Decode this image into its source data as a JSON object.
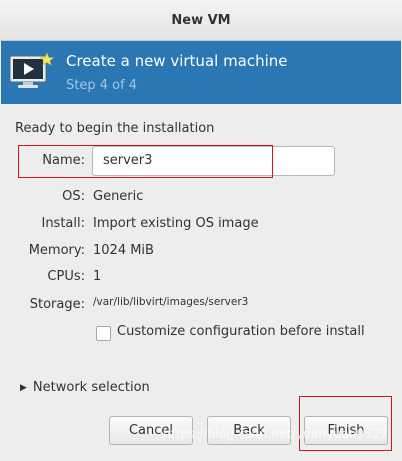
{
  "window": {
    "title": "New VM"
  },
  "banner": {
    "icon": "monitor-play-icon",
    "title": "Create a new virtual machine",
    "step": "Step 4 of 4"
  },
  "summary": {
    "heading": "Ready to begin the installation",
    "name_label": "Name:",
    "name_value": "server3",
    "os_label": "OS:",
    "os_value": "Generic",
    "install_label": "Install:",
    "install_value": "Import existing OS image",
    "memory_label": "Memory:",
    "memory_value": "1024 MiB",
    "cpus_label": "CPUs:",
    "cpus_value": "1",
    "storage_label": "Storage:",
    "storage_value": "/var/lib/libvirt/images/server3"
  },
  "customize": {
    "label": "Customize configuration before install",
    "checked": false
  },
  "network": {
    "label": "Network selection"
  },
  "buttons": {
    "cancel": "Cancel",
    "back": "Back",
    "finish": "Finish"
  },
  "watermark": "https://blog.csdn.net/yuanyuan9527",
  "colors": {
    "banner": "#2a77b3",
    "banner_step": "#9fc7ea",
    "highlight": "#d9141c"
  }
}
